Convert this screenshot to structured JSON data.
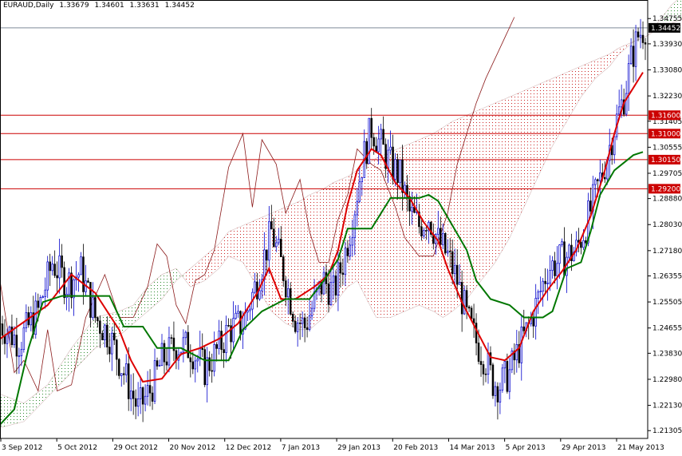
{
  "header": {
    "symbol": "EURAUD,Daily",
    "open": "1.33679",
    "high": "1.34601",
    "low": "1.33631",
    "close": "1.34452"
  },
  "colors": {
    "background": "#ffffff",
    "candle_up": "#0000cc",
    "candle_down": "#000000",
    "tenkan": "#dd0000",
    "kijun": "#007700",
    "chikou": "#8b1a1a",
    "cloud_bull": "#2e8b2e",
    "cloud_bear": "#cc2222",
    "level_line": "#cc0000",
    "level_badge": "#cc0000",
    "price_badge": "#000000",
    "price_line": "#7f8c9a"
  },
  "chart_data": {
    "type": "candlestick",
    "title": "EURAUD,Daily",
    "ylim": [
      1.2105,
      1.3497
    ],
    "x_ticks": [
      "3 Sep 2012",
      "5 Oct 2012",
      "29 Oct 2012",
      "20 Nov 2012",
      "12 Dec 2012",
      "7 Jan 2013",
      "29 Jan 2013",
      "20 Feb 2013",
      "14 Mar 2013",
      "5 Apr 2013",
      "29 Apr 2013",
      "21 May 2013"
    ],
    "y_ticks": [
      "1.34755",
      "1.33930",
      "1.33080",
      "1.32230",
      "1.31405",
      "1.30555",
      "1.29705",
      "1.28880",
      "1.28030",
      "1.27180",
      "1.26355",
      "1.25505",
      "1.24655",
      "1.23830",
      "1.22980",
      "1.22130",
      "1.21305"
    ],
    "current_price": "1.34452",
    "levels": [
      "1.31600",
      "1.31000",
      "1.30150",
      "1.29200"
    ],
    "close_path": [
      [
        0,
        1.248
      ],
      [
        8,
        1.242
      ],
      [
        16,
        1.252
      ],
      [
        22,
        1.268
      ],
      [
        28,
        1.261
      ],
      [
        34,
        1.265
      ],
      [
        40,
        1.25
      ],
      [
        46,
        1.244
      ],
      [
        52,
        1.232
      ],
      [
        58,
        1.22
      ],
      [
        63,
        1.226
      ],
      [
        68,
        1.236
      ],
      [
        74,
        1.241
      ],
      [
        80,
        1.24
      ],
      [
        86,
        1.233
      ],
      [
        92,
        1.24
      ],
      [
        96,
        1.246
      ],
      [
        102,
        1.248
      ],
      [
        108,
        1.262
      ],
      [
        114,
        1.278
      ],
      [
        119,
        1.265
      ],
      [
        124,
        1.25
      ],
      [
        128,
        1.247
      ],
      [
        132,
        1.255
      ],
      [
        136,
        1.262
      ],
      [
        140,
        1.258
      ],
      [
        144,
        1.268
      ],
      [
        148,
        1.282
      ],
      [
        152,
        1.3
      ],
      [
        156,
        1.312
      ],
      [
        160,
        1.306
      ],
      [
        164,
        1.3
      ],
      [
        168,
        1.296
      ],
      [
        172,
        1.284
      ],
      [
        176,
        1.28
      ],
      [
        180,
        1.283
      ],
      [
        184,
        1.275
      ],
      [
        188,
        1.27
      ],
      [
        192,
        1.262
      ],
      [
        196,
        1.25
      ],
      [
        200,
        1.242
      ],
      [
        204,
        1.236
      ],
      [
        207,
        1.229
      ],
      [
        210,
        1.228
      ],
      [
        214,
        1.232
      ],
      [
        218,
        1.24
      ],
      [
        222,
        1.247
      ],
      [
        226,
        1.256
      ],
      [
        230,
        1.266
      ],
      [
        234,
        1.268
      ],
      [
        238,
        1.27
      ],
      [
        242,
        1.272
      ],
      [
        246,
        1.28
      ],
      [
        250,
        1.29
      ],
      [
        254,
        1.3
      ],
      [
        258,
        1.312
      ],
      [
        262,
        1.322
      ],
      [
        265,
        1.334
      ],
      [
        268,
        1.342
      ],
      [
        271,
        1.345
      ]
    ],
    "tenkan": [
      [
        0,
        1.243
      ],
      [
        20,
        1.254
      ],
      [
        30,
        1.264
      ],
      [
        40,
        1.258
      ],
      [
        50,
        1.246
      ],
      [
        55,
        1.236
      ],
      [
        60,
        1.229
      ],
      [
        68,
        1.23
      ],
      [
        76,
        1.238
      ],
      [
        84,
        1.24
      ],
      [
        92,
        1.243
      ],
      [
        100,
        1.248
      ],
      [
        108,
        1.258
      ],
      [
        113,
        1.266
      ],
      [
        118,
        1.256
      ],
      [
        124,
        1.256
      ],
      [
        132,
        1.26
      ],
      [
        138,
        1.264
      ],
      [
        142,
        1.272
      ],
      [
        146,
        1.287
      ],
      [
        150,
        1.298
      ],
      [
        156,
        1.305
      ],
      [
        160,
        1.303
      ],
      [
        166,
        1.294
      ],
      [
        172,
        1.289
      ],
      [
        178,
        1.281
      ],
      [
        184,
        1.275
      ],
      [
        188,
        1.266
      ],
      [
        194,
        1.255
      ],
      [
        200,
        1.246
      ],
      [
        206,
        1.237
      ],
      [
        212,
        1.236
      ],
      [
        218,
        1.24
      ],
      [
        224,
        1.252
      ],
      [
        230,
        1.259
      ],
      [
        236,
        1.265
      ],
      [
        242,
        1.272
      ],
      [
        248,
        1.283
      ],
      [
        254,
        1.298
      ],
      [
        258,
        1.31
      ],
      [
        262,
        1.32
      ],
      [
        266,
        1.325
      ],
      [
        270,
        1.33
      ]
    ],
    "kijun": [
      [
        0,
        1.215
      ],
      [
        6,
        1.22
      ],
      [
        12,
        1.24
      ],
      [
        18,
        1.255
      ],
      [
        26,
        1.257
      ],
      [
        35,
        1.257
      ],
      [
        46,
        1.257
      ],
      [
        52,
        1.247
      ],
      [
        60,
        1.247
      ],
      [
        66,
        1.24
      ],
      [
        76,
        1.24
      ],
      [
        86,
        1.236
      ],
      [
        96,
        1.236
      ],
      [
        102,
        1.246
      ],
      [
        110,
        1.252
      ],
      [
        120,
        1.256
      ],
      [
        130,
        1.256
      ],
      [
        136,
        1.262
      ],
      [
        142,
        1.269
      ],
      [
        146,
        1.279
      ],
      [
        156,
        1.279
      ],
      [
        164,
        1.289
      ],
      [
        168,
        1.289
      ],
      [
        172,
        1.289
      ],
      [
        176,
        1.289
      ],
      [
        180,
        1.29
      ],
      [
        184,
        1.288
      ],
      [
        190,
        1.28
      ],
      [
        196,
        1.272
      ],
      [
        200,
        1.262
      ],
      [
        206,
        1.256
      ],
      [
        214,
        1.254
      ],
      [
        220,
        1.25
      ],
      [
        228,
        1.25
      ],
      [
        232,
        1.252
      ],
      [
        238,
        1.266
      ],
      [
        244,
        1.268
      ],
      [
        248,
        1.278
      ],
      [
        252,
        1.29
      ],
      [
        258,
        1.298
      ],
      [
        266,
        1.303
      ],
      [
        270,
        1.304
      ]
    ],
    "chikou": [
      [
        0,
        1.262
      ],
      [
        6,
        1.232
      ],
      [
        10,
        1.236
      ],
      [
        16,
        1.226
      ],
      [
        20,
        1.246
      ],
      [
        24,
        1.226
      ],
      [
        30,
        1.228
      ],
      [
        36,
        1.25
      ],
      [
        44,
        1.264
      ],
      [
        50,
        1.25
      ],
      [
        56,
        1.25
      ],
      [
        62,
        1.26
      ],
      [
        66,
        1.274
      ],
      [
        70,
        1.27
      ],
      [
        74,
        1.254
      ],
      [
        78,
        1.248
      ],
      [
        82,
        1.262
      ],
      [
        86,
        1.264
      ],
      [
        90,
        1.272
      ],
      [
        96,
        1.299
      ],
      [
        102,
        1.31
      ],
      [
        106,
        1.286
      ],
      [
        110,
        1.308
      ],
      [
        116,
        1.3
      ],
      [
        120,
        1.284
      ],
      [
        126,
        1.295
      ],
      [
        130,
        1.278
      ],
      [
        134,
        1.268
      ],
      [
        138,
        1.268
      ],
      [
        142,
        1.282
      ],
      [
        146,
        1.29
      ],
      [
        150,
        1.305
      ],
      [
        156,
        1.3
      ],
      [
        160,
        1.298
      ],
      [
        166,
        1.286
      ],
      [
        170,
        1.276
      ],
      [
        176,
        1.27
      ],
      [
        182,
        1.27
      ],
      [
        188,
        1.284
      ],
      [
        192,
        1.3
      ],
      [
        196,
        1.31
      ],
      [
        200,
        1.32
      ],
      [
        204,
        1.328
      ],
      [
        210,
        1.338
      ],
      [
        216,
        1.348
      ]
    ],
    "span_a": [
      [
        0,
        1.225
      ],
      [
        10,
        1.222
      ],
      [
        20,
        1.228
      ],
      [
        30,
        1.24
      ],
      [
        40,
        1.25
      ],
      [
        50,
        1.252
      ],
      [
        56,
        1.254
      ],
      [
        62,
        1.26
      ],
      [
        68,
        1.264
      ],
      [
        74,
        1.266
      ],
      [
        80,
        1.26
      ],
      [
        86,
        1.262
      ],
      [
        92,
        1.266
      ],
      [
        96,
        1.27
      ],
      [
        102,
        1.268
      ],
      [
        108,
        1.26
      ],
      [
        114,
        1.252
      ],
      [
        120,
        1.248
      ],
      [
        126,
        1.246
      ],
      [
        130,
        1.246
      ],
      [
        136,
        1.25
      ],
      [
        140,
        1.254
      ],
      [
        146,
        1.26
      ],
      [
        150,
        1.262
      ],
      [
        154,
        1.256
      ],
      [
        158,
        1.25
      ],
      [
        164,
        1.25
      ],
      [
        170,
        1.252
      ],
      [
        176,
        1.254
      ],
      [
        182,
        1.252
      ],
      [
        186,
        1.25
      ],
      [
        190,
        1.252
      ],
      [
        196,
        1.256
      ],
      [
        202,
        1.262
      ],
      [
        208,
        1.268
      ],
      [
        214,
        1.276
      ],
      [
        220,
        1.286
      ],
      [
        226,
        1.296
      ],
      [
        232,
        1.306
      ],
      [
        238,
        1.314
      ],
      [
        244,
        1.322
      ],
      [
        250,
        1.328
      ],
      [
        256,
        1.332
      ],
      [
        260,
        1.336
      ],
      [
        266,
        1.34
      ],
      [
        272,
        1.342
      ],
      [
        276,
        1.346
      ],
      [
        282,
        1.352
      ],
      [
        288,
        1.356
      ],
      [
        294,
        1.36
      ],
      [
        300,
        1.364
      ],
      [
        306,
        1.368
      ]
    ],
    "span_b": [
      [
        0,
        1.214
      ],
      [
        10,
        1.216
      ],
      [
        20,
        1.224
      ],
      [
        30,
        1.232
      ],
      [
        40,
        1.24
      ],
      [
        50,
        1.244
      ],
      [
        56,
        1.248
      ],
      [
        62,
        1.252
      ],
      [
        68,
        1.256
      ],
      [
        74,
        1.262
      ],
      [
        80,
        1.266
      ],
      [
        86,
        1.27
      ],
      [
        92,
        1.274
      ],
      [
        96,
        1.278
      ],
      [
        102,
        1.28
      ],
      [
        108,
        1.282
      ],
      [
        114,
        1.284
      ],
      [
        120,
        1.286
      ],
      [
        126,
        1.288
      ],
      [
        130,
        1.29
      ],
      [
        136,
        1.292
      ],
      [
        140,
        1.294
      ],
      [
        146,
        1.296
      ],
      [
        150,
        1.298
      ],
      [
        154,
        1.3
      ],
      [
        158,
        1.302
      ],
      [
        164,
        1.304
      ],
      [
        170,
        1.306
      ],
      [
        176,
        1.308
      ],
      [
        182,
        1.31
      ],
      [
        186,
        1.312
      ],
      [
        190,
        1.314
      ],
      [
        196,
        1.316
      ],
      [
        202,
        1.318
      ],
      [
        208,
        1.32
      ],
      [
        214,
        1.322
      ],
      [
        220,
        1.324
      ],
      [
        226,
        1.326
      ],
      [
        232,
        1.328
      ],
      [
        238,
        1.33
      ],
      [
        244,
        1.332
      ],
      [
        250,
        1.334
      ],
      [
        256,
        1.336
      ],
      [
        260,
        1.338
      ],
      [
        266,
        1.34
      ],
      [
        272,
        1.342
      ],
      [
        276,
        1.344
      ],
      [
        282,
        1.346
      ],
      [
        288,
        1.348
      ],
      [
        294,
        1.35
      ],
      [
        300,
        1.352
      ],
      [
        306,
        1.354
      ]
    ]
  }
}
